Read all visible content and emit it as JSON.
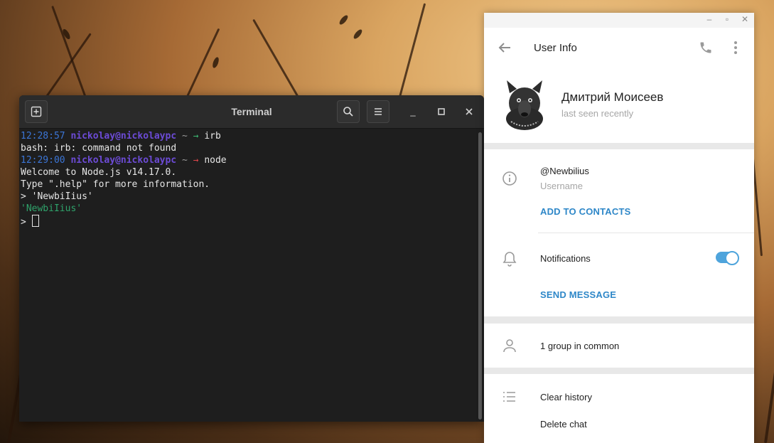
{
  "terminal": {
    "title": "Terminal",
    "lines": [
      {
        "time": "12:28:57",
        "user": "nickolay@nickolaypc",
        "tilde": "~",
        "arrow": "→",
        "cmd": "irb"
      },
      {
        "text": "bash: irb: command not found"
      },
      {
        "time": "12:29:00",
        "user": "nickolay@nickolaypc",
        "tilde": "~",
        "arrow": "→",
        "cmd": "node"
      },
      {
        "text": "Welcome to Node.js v14.17.0."
      },
      {
        "text": "Type \".help\" for more information."
      },
      {
        "text": "> 'NewbiIius'"
      },
      {
        "text": "'NewbiIius'"
      },
      {
        "text": ">"
      }
    ]
  },
  "userinfo": {
    "header_title": "User Info",
    "name": "Дмитрий Моисеев",
    "last_seen": "last seen recently",
    "username": "@Newbilius",
    "username_label": "Username",
    "add_to_contacts": "ADD TO CONTACTS",
    "notifications_label": "Notifications",
    "notifications_on": true,
    "send_message": "SEND MESSAGE",
    "groups_in_common": "1 group in common",
    "clear_history": "Clear history",
    "delete_chat": "Delete chat"
  },
  "colors": {
    "accent": "#2e87c8",
    "toggle": "#4ea4dc",
    "terminal_bg": "#1e1e1e"
  }
}
